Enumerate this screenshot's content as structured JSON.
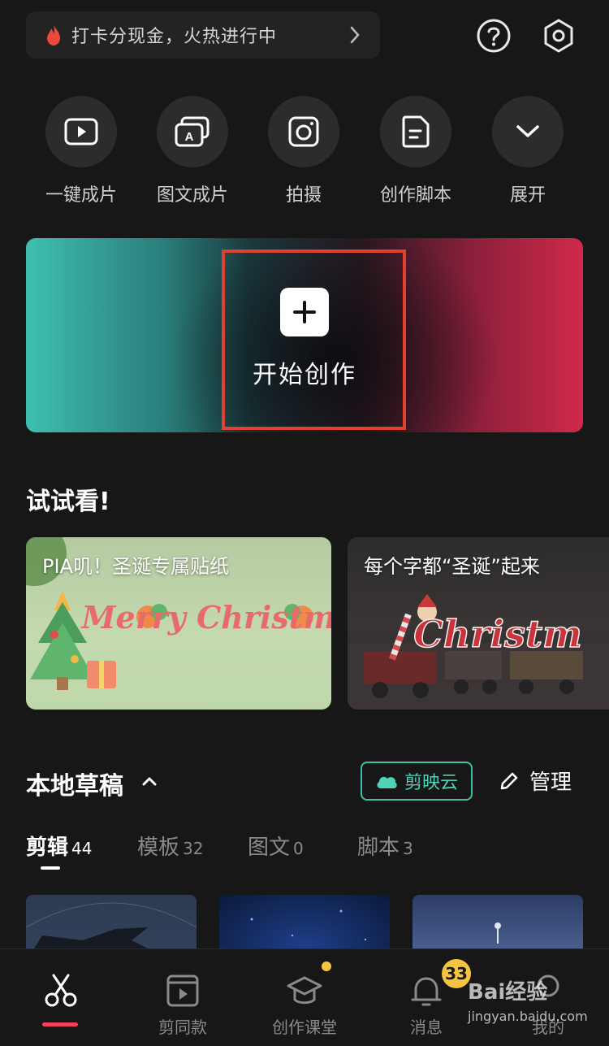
{
  "promo": {
    "text": "打卡分现金，火热进行中"
  },
  "quick_tools": [
    {
      "label": "一键成片",
      "icon": "video-play-icon"
    },
    {
      "label": "图文成片",
      "icon": "image-text-icon"
    },
    {
      "label": "拍摄",
      "icon": "camera-icon"
    },
    {
      "label": "创作脚本",
      "icon": "script-doc-icon"
    },
    {
      "label": "展开",
      "icon": "chevron-down-icon"
    }
  ],
  "start": {
    "label": "开始创作"
  },
  "try_section": {
    "title": "试试看!",
    "cards": [
      {
        "title": "PIA叽！圣诞专属贴纸",
        "art_text": "Merry Christmas"
      },
      {
        "title": "每个字都“圣诞”起来",
        "art_text": "Christm"
      }
    ]
  },
  "drafts": {
    "title": "本地草稿",
    "cloud_label": "剪映云",
    "manage_label": "管理",
    "tabs": [
      {
        "name": "剪辑",
        "count": "44"
      },
      {
        "name": "模板",
        "count": "32"
      },
      {
        "name": "图文",
        "count": "0"
      },
      {
        "name": "脚本",
        "count": "3"
      }
    ]
  },
  "bottom_nav": {
    "items": [
      {
        "label": "",
        "icon": "scissors-icon"
      },
      {
        "label": "剪同款",
        "icon": "template-film-icon"
      },
      {
        "label": "创作课堂",
        "icon": "graduation-cap-icon"
      },
      {
        "label": "消息",
        "icon": "bell-icon"
      },
      {
        "label": "我的",
        "icon": "profile-icon"
      }
    ],
    "message_badge": "33"
  },
  "watermark": {
    "line1": "Bai经验",
    "line2": "jingyan.baidu.com"
  },
  "colors": {
    "accent_red": "#f0435a",
    "cloud_teal": "#4fd2b8",
    "badge_yellow": "#f5c542",
    "highlight_box": "#e0422f"
  }
}
